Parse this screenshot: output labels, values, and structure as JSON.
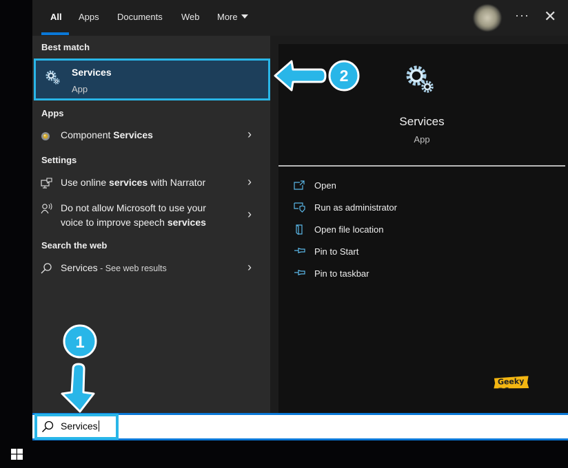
{
  "header": {
    "tabs": [
      {
        "label": "All",
        "active": true
      },
      {
        "label": "Apps"
      },
      {
        "label": "Documents"
      },
      {
        "label": "Web"
      },
      {
        "label": "More"
      }
    ],
    "ellipsis": "···",
    "close": "✕"
  },
  "left": {
    "best_match_header": "Best match",
    "best_match": {
      "title": "Services",
      "subtitle": "App",
      "icon": "services-gear-icon"
    },
    "apps_header": "Apps",
    "apps": [
      {
        "prefix": "Component ",
        "bold": "Services",
        "icon": "component-services-icon"
      }
    ],
    "settings_header": "Settings",
    "settings": [
      {
        "pre": "Use online ",
        "bold": "services",
        "post": " with Narrator",
        "icon": "narrator-icon"
      },
      {
        "line1": "Do not allow Microsoft to use your",
        "line2_pre": "voice to improve speech ",
        "line2_bold": "services",
        "icon": "speech-icon"
      }
    ],
    "web_header": "Search the web",
    "web": {
      "query": "Services",
      "hint": " - See web results",
      "icon": "search-icon"
    }
  },
  "right": {
    "title": "Services",
    "subtitle": "App",
    "actions": [
      {
        "label": "Open",
        "icon": "open-icon"
      },
      {
        "label": "Run as administrator",
        "icon": "run-as-admin-icon"
      },
      {
        "label": "Open file location",
        "icon": "file-location-icon"
      },
      {
        "label": "Pin to Start",
        "icon": "pin-icon"
      },
      {
        "label": "Pin to taskbar",
        "icon": "pin-icon"
      }
    ]
  },
  "search": {
    "value": "Services"
  },
  "annotations": {
    "step1": "1",
    "step2": "2",
    "accent": "#29b6e8"
  },
  "watermark": "Geeky PC",
  "colors": {
    "accent_blue": "#0a78d7",
    "highlight": "#29b6e8",
    "selected_bg": "#1d3f5b"
  }
}
